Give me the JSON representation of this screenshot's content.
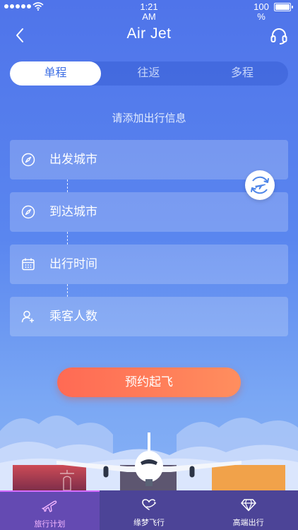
{
  "status_bar": {
    "time": "1:21\nAM",
    "time_line1": "1:21",
    "time_line2": "AM",
    "battery_line1": "100",
    "battery_line2": "%"
  },
  "nav": {
    "title": "Air Jet",
    "back_icon": "chevron-left-icon",
    "support_icon": "headset-icon"
  },
  "trip_types": [
    {
      "label": "单程",
      "active": true
    },
    {
      "label": "往返",
      "active": false
    },
    {
      "label": "多程",
      "active": false
    }
  ],
  "hint": "请添加出行信息",
  "fields": [
    {
      "label": "出发城市",
      "icon": "compass-icon"
    },
    {
      "label": "到达城市",
      "icon": "compass-icon"
    },
    {
      "label": "出行时间",
      "icon": "calendar-icon"
    },
    {
      "label": "乘客人数",
      "icon": "add-person-icon"
    }
  ],
  "swap_icon": "swap-plane-icon",
  "book_button": "预约起飞",
  "tabs": [
    {
      "label": "旅行计划",
      "icon": "plane-icon",
      "active": true
    },
    {
      "label": "缘梦飞行",
      "icon": "heart-plane-icon",
      "active": false
    },
    {
      "label": "高端出行",
      "icon": "diamond-icon",
      "active": false
    }
  ],
  "colors": {
    "accent": "#3e6fe4",
    "button_start": "#ff6a54",
    "button_end": "#ff8e5e",
    "tab_active": "#f3b6ff"
  }
}
